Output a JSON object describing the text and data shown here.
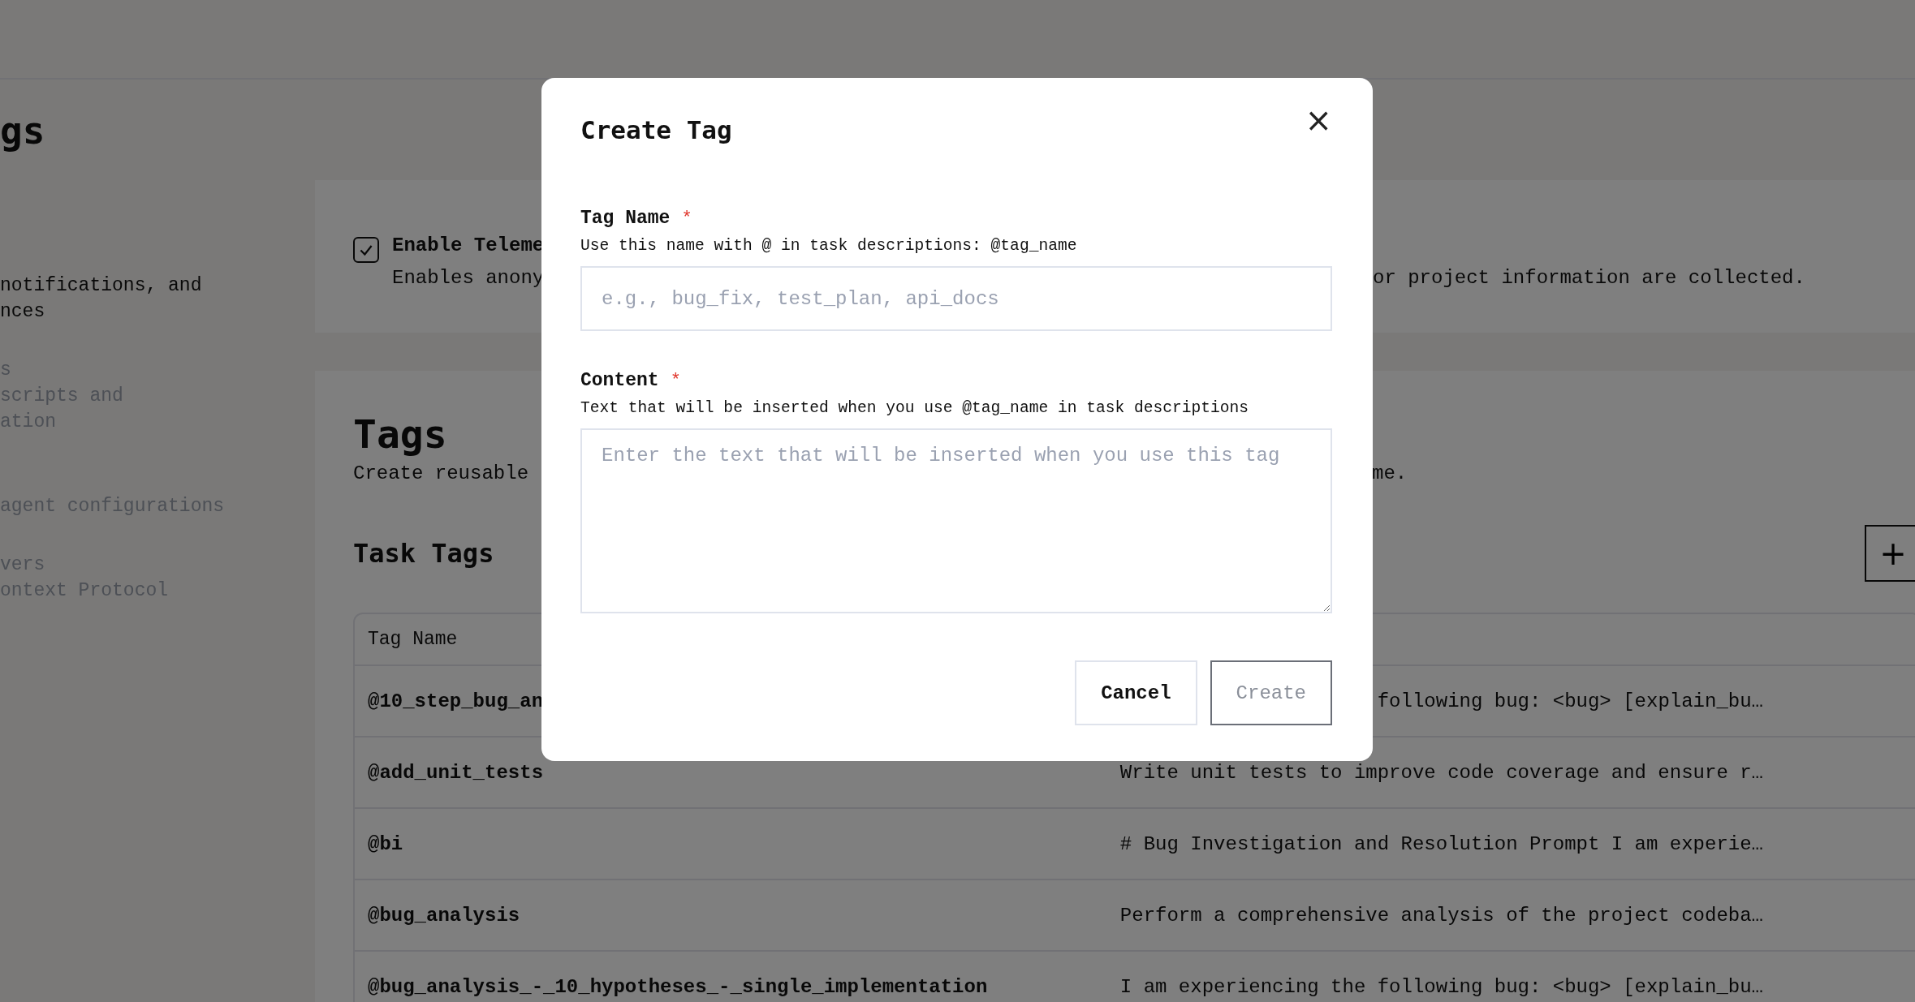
{
  "sidebar": {
    "title": "gs",
    "items": [
      {
        "description_lines": [
          "notifications, and",
          "nces"
        ],
        "selected": true
      },
      {
        "title": "s",
        "description_lines": [
          "scripts and",
          "ation"
        ],
        "selected": false
      },
      {
        "description_lines": [
          "agent configurations"
        ],
        "selected": false
      },
      {
        "title": "vers",
        "description_lines": [
          "ontext Protocol"
        ],
        "selected": false
      }
    ]
  },
  "telemetry": {
    "checked": true,
    "label": "Enable Teleme",
    "description_left": "Enables anony",
    "description_right": "or project information are collected."
  },
  "tags_section": {
    "title": "Tags",
    "description_left": "Create reusable ",
    "description_right": "me.",
    "subtitle": "Task Tags",
    "add_button": "+",
    "table": {
      "columns": [
        "Tag Name"
      ],
      "rows": [
        {
          "name": "@10_step_bug_an",
          "content": "following bug: <bug> [explain_bu…"
        },
        {
          "name": "@add_unit_tests",
          "content": "Write unit tests to improve code coverage and ensure r…"
        },
        {
          "name": "@bi",
          "content": "# Bug Investigation and Resolution Prompt I am experie…"
        },
        {
          "name": "@bug_analysis",
          "content": "Perform a comprehensive analysis of the project codeba…"
        },
        {
          "name": "@bug_analysis_-_10_hypotheses_-_single_implementation",
          "content": "I am experiencing the following bug: <bug> [explain_bu…"
        }
      ]
    }
  },
  "dialog": {
    "title": "Create Tag",
    "close": "×",
    "fields": [
      {
        "kind": "input",
        "label": "Tag Name",
        "required_marker": "*",
        "help": "Use this name with @ in task descriptions: @tag_name",
        "placeholder": "e.g., bug_fix, test_plan, api_docs"
      },
      {
        "kind": "textarea",
        "label": "Content",
        "required_marker": "*",
        "help": "Text that will be inserted when you use @tag_name in task descriptions",
        "placeholder": "Enter the text that will be inserted when you use this tag"
      }
    ],
    "buttons": [
      {
        "label": "Cancel",
        "disabled": false
      },
      {
        "label": "Create",
        "disabled": true
      }
    ]
  }
}
